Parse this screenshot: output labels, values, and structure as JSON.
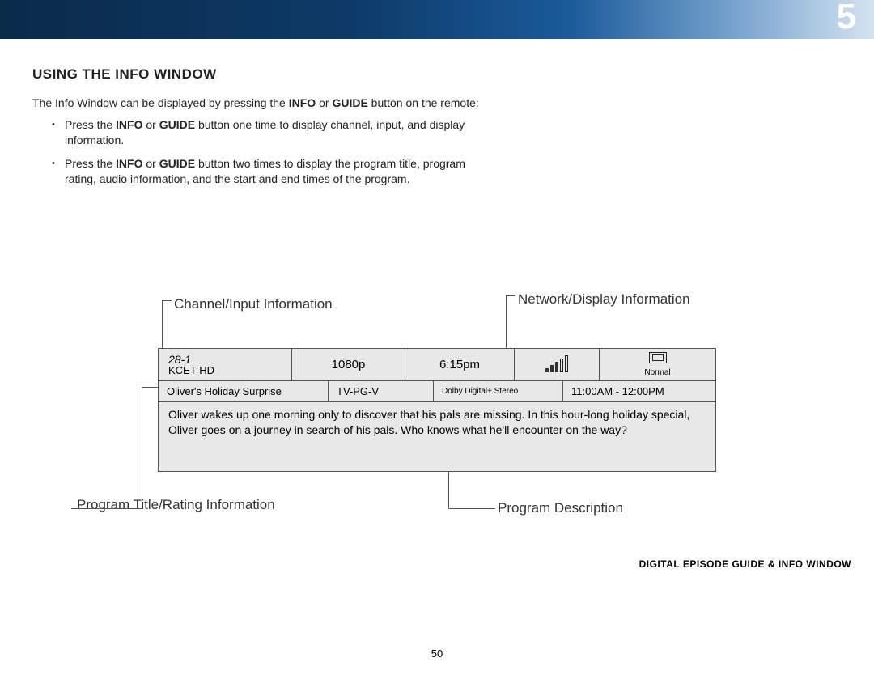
{
  "header": {
    "chapter": "5"
  },
  "section": {
    "heading": "USING THE INFO WINDOW",
    "intro_pre": "The Info Window can be displayed by pressing the ",
    "intro_b1": "INFO",
    "intro_mid": " or ",
    "intro_b2": "GUIDE",
    "intro_post": " button on the remote:",
    "bullet1_pre": "Press the ",
    "bullet1_b1": "INFO",
    "bullet1_mid": " or ",
    "bullet1_b2": "GUIDE",
    "bullet1_post": " button one time to display channel, input, and display information.",
    "bullet2_pre": "Press the ",
    "bullet2_b1": "INFO",
    "bullet2_mid": " or ",
    "bullet2_b2": "GUIDE",
    "bullet2_post": " button two times to display the program title, program rating, audio information, and the start and end times of the program."
  },
  "callouts": {
    "top_left": "Channel/Input Information",
    "top_right": "Network/Display Information",
    "bottom_left": "Program Title/Rating Information",
    "bottom_right": "Program Description"
  },
  "info": {
    "channel_number": "28-1",
    "channel_name": "KCET-HD",
    "resolution": "1080p",
    "clock": "6:15pm",
    "aspect_label": "Normal",
    "program_title": "Oliver's Holiday Surprise",
    "rating": "TV-PG-V",
    "audio": "Dolby Digital+ Stereo",
    "times": "11:00AM - 12:00PM",
    "description": "Oliver wakes up one morning only to discover that his pals are missing. In this hour-long holiday special, Oliver goes on a journey in search of his pals. Who knows what he'll encounter on the way?"
  },
  "footer": {
    "label": "DIGITAL EPISODE GUIDE & INFO WINDOW",
    "page": "50"
  }
}
